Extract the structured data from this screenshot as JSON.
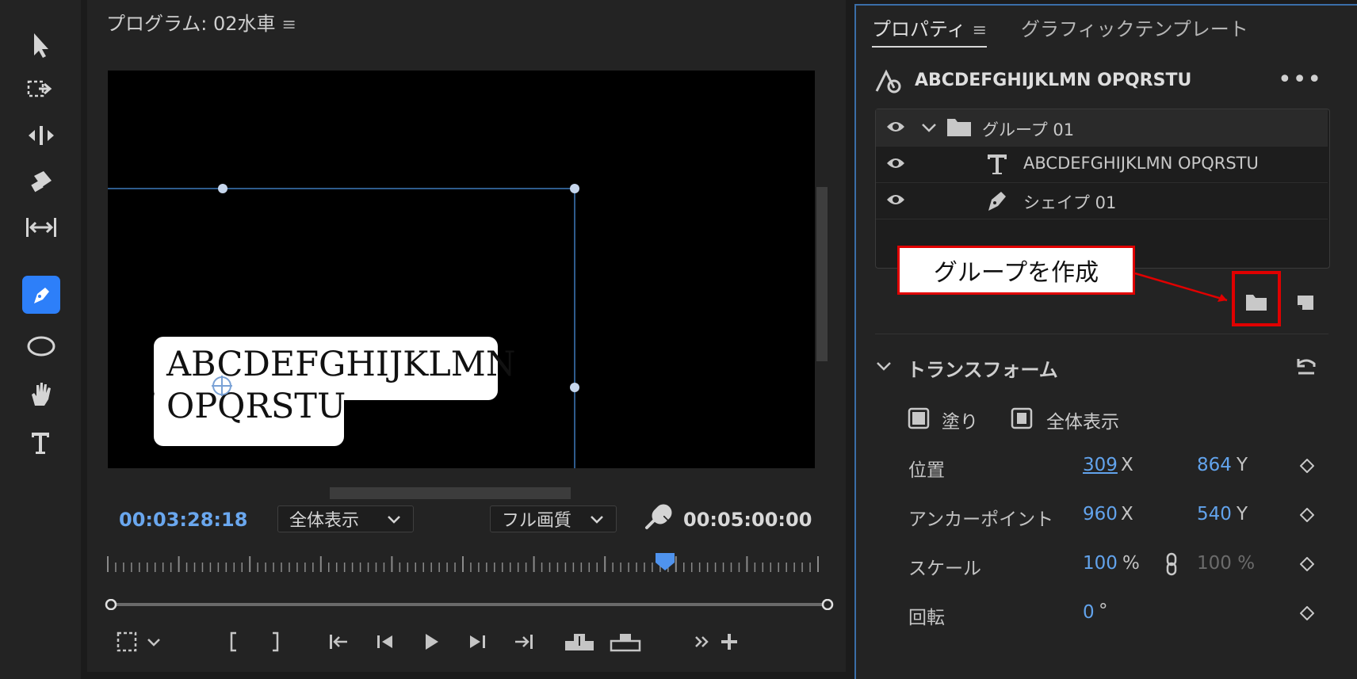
{
  "tools": [
    {
      "name": "selection-tool",
      "active": false
    },
    {
      "name": "track-select-tool",
      "active": false
    },
    {
      "name": "ripple-edit-tool",
      "active": false
    },
    {
      "name": "razor-tool",
      "active": false
    },
    {
      "name": "slip-tool",
      "active": false
    },
    {
      "name": "pen-tool",
      "active": true
    },
    {
      "name": "ellipse-tool",
      "active": false
    },
    {
      "name": "hand-tool",
      "active": false
    },
    {
      "name": "type-tool",
      "active": false
    }
  ],
  "monitor": {
    "title": "プログラム: 02水車",
    "overlay_text_line1": "ABCDEFGHIJKLMN",
    "overlay_text_line2": "OPQRSTU",
    "current_timecode": "00:03:28:18",
    "zoom_dropdown": "全体表示",
    "quality_dropdown": "フル画質",
    "duration_timecode": "00:05:00:00",
    "playhead_fraction": 0.785,
    "accent_color": "#6aa7ee"
  },
  "props": {
    "tabs": [
      {
        "label": "プロパティ",
        "active": true
      },
      {
        "label": "グラフィックテンプレート",
        "active": false
      }
    ],
    "object_title": "ABCDEFGHIJKLMN OPQRSTU",
    "layers": [
      {
        "label": "グループ 01",
        "type": "group"
      },
      {
        "label": "ABCDEFGHIJKLMN OPQRSTU",
        "type": "text"
      },
      {
        "label": "シェイプ 01",
        "type": "shape"
      }
    ],
    "callout": "グループを作成",
    "callout_color": "#e00000",
    "transform": {
      "title": "トランスフォーム",
      "fill_label": "塗り",
      "fit_label": "全体表示",
      "position_label": "位置",
      "position_x": "309",
      "position_y": "864",
      "anchor_label": "アンカーポイント",
      "anchor_x": "960",
      "anchor_y": "540",
      "scale_label": "スケール",
      "scale_value": "100",
      "scale_value2": "100 %",
      "rotation_label": "回転",
      "rotation_value": "0",
      "x_unit": "X",
      "y_unit": "Y",
      "percent_unit": "%",
      "degree_unit": "°"
    }
  }
}
